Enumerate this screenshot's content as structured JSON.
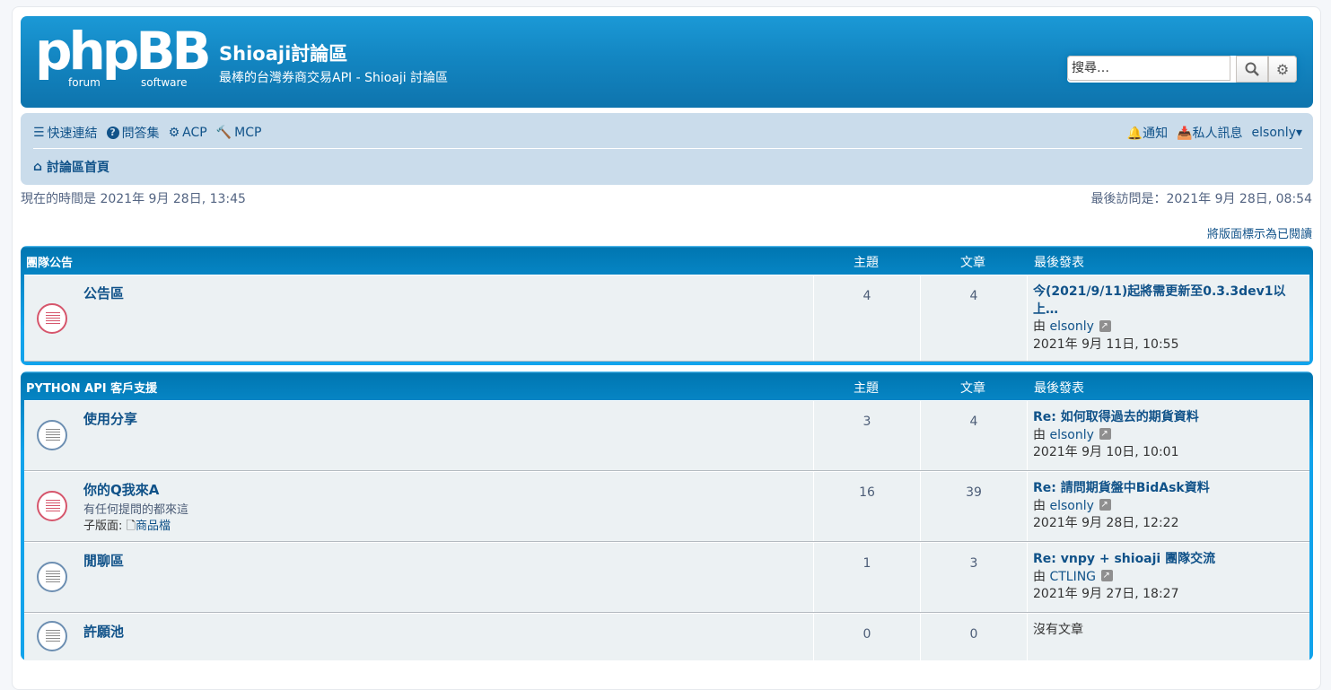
{
  "header": {
    "logo_text": "phpBB",
    "logo_sub_left": "forum",
    "logo_sub_right": "software",
    "site_title": "Shioaji討論區",
    "site_desc": "最棒的台灣券商交易API - Shioaji 討論區",
    "search_placeholder": "搜尋…"
  },
  "nav": {
    "quick_links": "快速連結",
    "faq": "問答集",
    "acp": "ACP",
    "mcp": "MCP",
    "notifications": "通知",
    "pm": "私人訊息",
    "user": "elsonly",
    "breadcrumb_home": "討論區首頁"
  },
  "times": {
    "now": "現在的時間是 2021年 9月 28日, 13:45",
    "last_visit": "最後訪問是：2021年 9月 28日, 08:54",
    "mark_read": "將版面標示為已閱讀"
  },
  "sections": [
    {
      "title": "團隊公告",
      "col_topics": "主題",
      "col_posts": "文章",
      "col_last": "最後發表",
      "forums": [
        {
          "name": "公告區",
          "topics": "4",
          "posts": "4",
          "icon": "red",
          "last_title": "今(2021/9/11)起將需更新至0.3.3dev1以上…",
          "last_by": "由",
          "last_author": "elsonly",
          "last_time": "2021年 9月 11日, 10:55"
        }
      ]
    },
    {
      "title": "PYTHON API 客戶支援",
      "col_topics": "主題",
      "col_posts": "文章",
      "col_last": "最後發表",
      "forums": [
        {
          "name": "使用分享",
          "topics": "3",
          "posts": "4",
          "icon": "blue",
          "last_title": "Re: 如何取得過去的期貨資料",
          "last_by": "由",
          "last_author": "elsonly",
          "last_time": "2021年 9月 10日, 10:01"
        },
        {
          "name": "你的Q我來A",
          "desc": "有任何提問的都來這",
          "sub_label": "子版面:",
          "sub_name": "商品檔",
          "topics": "16",
          "posts": "39",
          "icon": "red",
          "last_title": "Re: 請問期貨盤中BidAsk資料",
          "last_by": "由",
          "last_author": "elsonly",
          "last_time": "2021年 9月 28日, 12:22"
        },
        {
          "name": "閒聊區",
          "topics": "1",
          "posts": "3",
          "icon": "blue",
          "last_title": "Re: vnpy + shioaji 團隊交流",
          "last_by": "由",
          "last_author": "CTLING",
          "last_time": "2021年 9月 27日, 18:27"
        },
        {
          "name": "許願池",
          "topics": "0",
          "posts": "0",
          "icon": "blue",
          "no_posts": "沒有文章"
        }
      ]
    }
  ]
}
